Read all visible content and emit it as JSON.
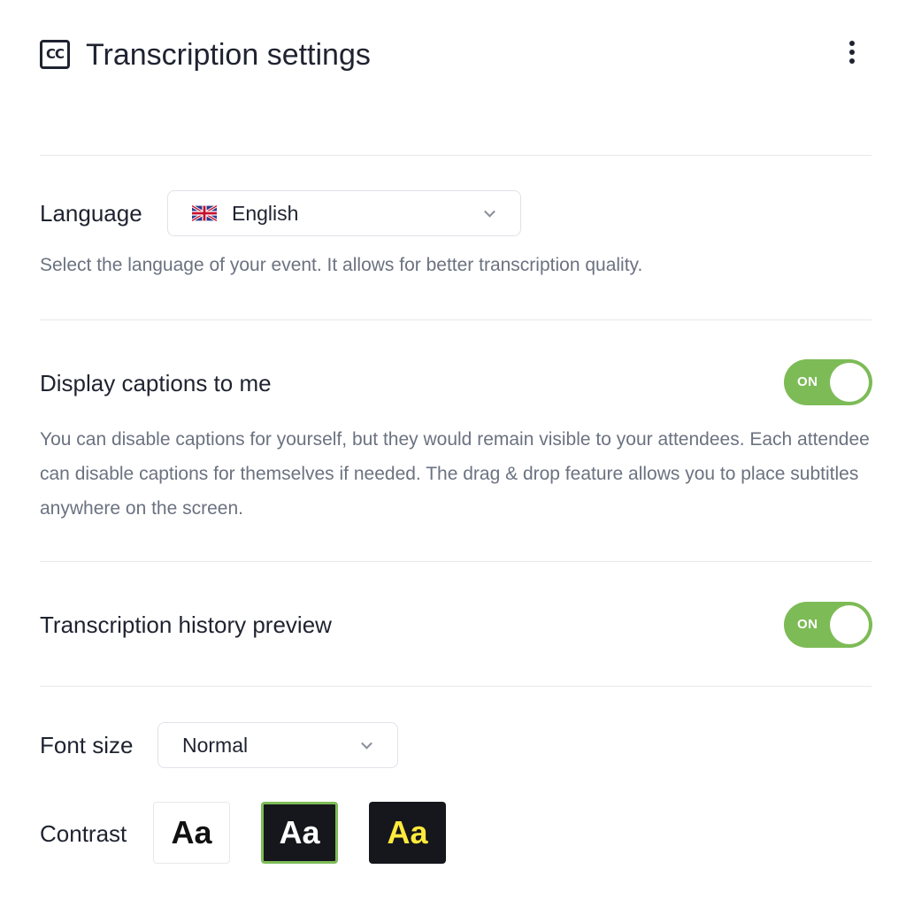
{
  "header": {
    "icon": "closed-captions-icon",
    "title": "Transcription settings",
    "menu_icon": "more-vertical-icon"
  },
  "language": {
    "label": "Language",
    "selected": "English",
    "flag_icon": "uk-flag-icon",
    "description": "Select the language of your event. It allows for better transcription quality."
  },
  "display_captions": {
    "label": "Display captions to me",
    "toggle_label": "ON",
    "enabled": true,
    "description": "You can disable captions for yourself, but they would remain visible to your attendees. Each attendee can disable captions for themselves if needed. The drag & drop feature allows you to place subtitles anywhere on the screen."
  },
  "history_preview": {
    "label": "Transcription history preview",
    "toggle_label": "ON",
    "enabled": true
  },
  "font_size": {
    "label": "Font size",
    "selected": "Normal"
  },
  "contrast": {
    "label": "Contrast",
    "options": [
      {
        "text": "Aa",
        "name": "light",
        "bg": "#ffffff",
        "fg": "#111111"
      },
      {
        "text": "Aa",
        "name": "dark",
        "bg": "#15171c",
        "fg": "#ffffff",
        "selected": true
      },
      {
        "text": "Aa",
        "name": "dark-yellow",
        "bg": "#15171c",
        "fg": "#ffea3d"
      }
    ]
  },
  "colors": {
    "accent": "#7dbb57",
    "text": "#1f2330",
    "muted": "#6b7280",
    "divider": "#e6e8ec"
  }
}
